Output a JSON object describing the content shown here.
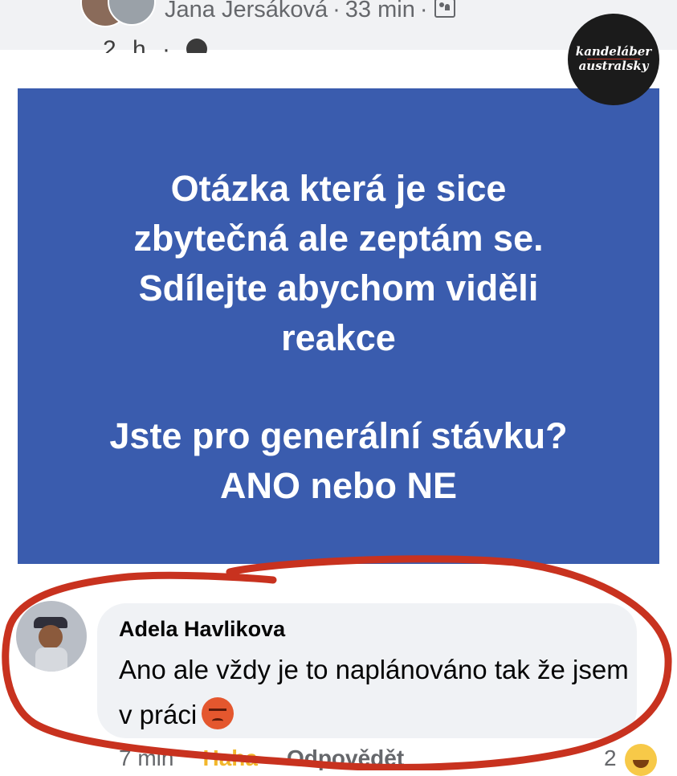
{
  "post": {
    "author": "Jana Jersáková",
    "time": "33 min",
    "meta_cut": "2 h ·",
    "text_lines": [
      "Otázka která je sice",
      "zbytečná ale zeptám se.",
      "Sdílejte abychom viděli",
      "reakce",
      "Jste pro generální stávku?",
      "ANO nebo NE"
    ],
    "panel_color": "#3a5cae"
  },
  "logo": {
    "line1": "kandeláber",
    "line2": "australsky"
  },
  "comment": {
    "author": "Adela Havlikova",
    "text": "Ano ale vždy je to naplánováno tak že jsem v práci",
    "time": "7 min",
    "reaction_label": "Haha",
    "reply_label": "Odpovědět",
    "reaction_count": "2"
  },
  "icons": [
    "group-icon",
    "globe-icon",
    "angry-emoji-icon",
    "laugh-emoji-icon"
  ],
  "annotation_color": "#c8321f"
}
